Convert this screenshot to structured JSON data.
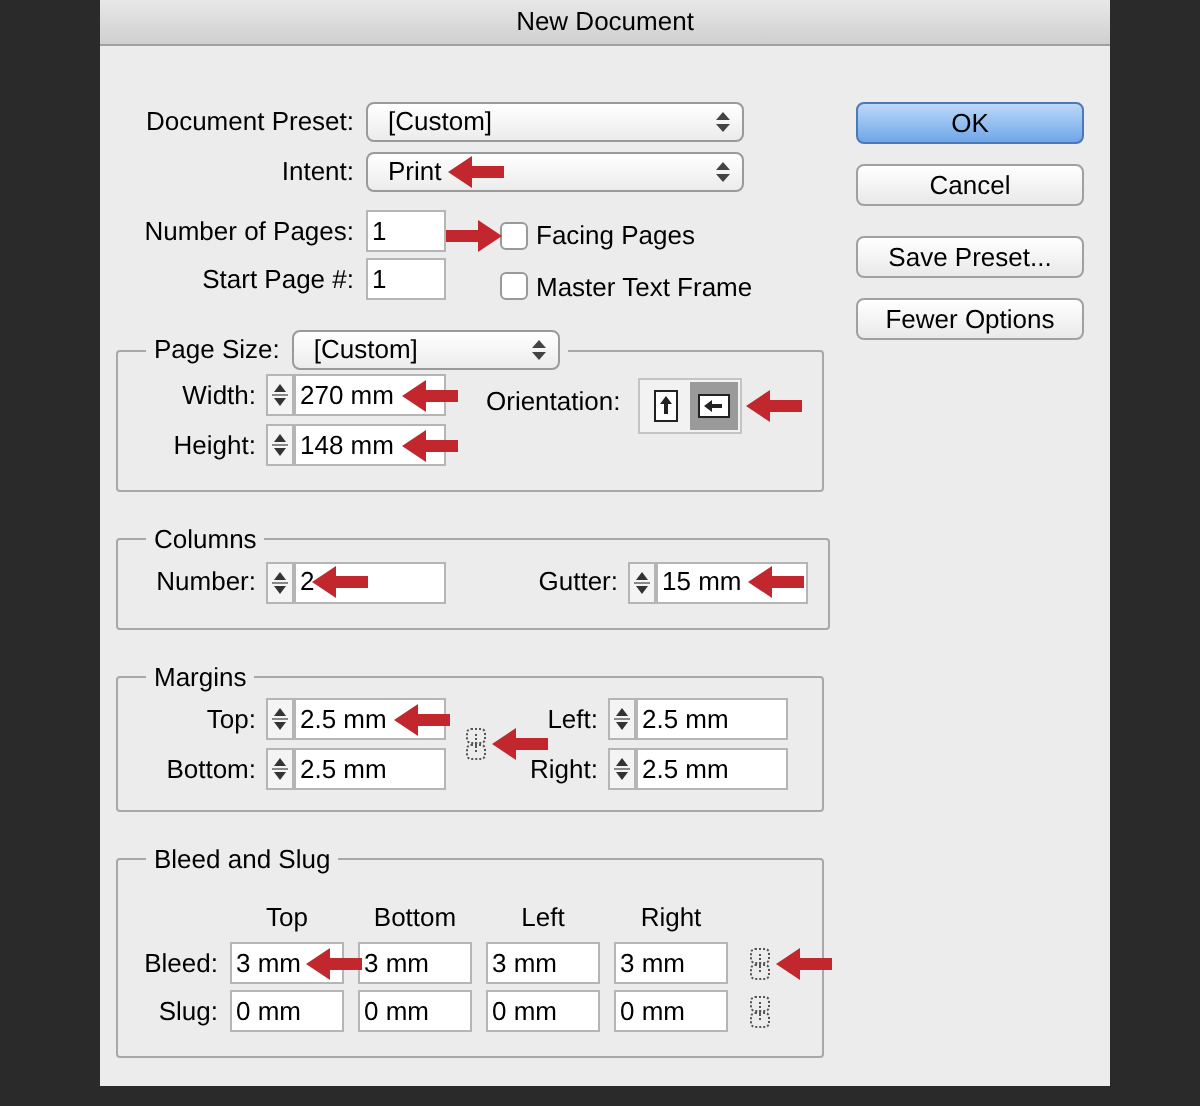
{
  "window": {
    "title": "New Document"
  },
  "document_preset": {
    "label": "Document Preset:",
    "value": "[Custom]"
  },
  "intent": {
    "label": "Intent:",
    "value": "Print",
    "arrow": true
  },
  "number_of_pages": {
    "label": "Number of Pages:",
    "value": "1"
  },
  "start_page": {
    "label": "Start Page #:",
    "value": "1"
  },
  "checkboxes": [
    {
      "label": "Facing Pages",
      "checked": false,
      "arrow": true
    },
    {
      "label": "Master Text Frame",
      "checked": false
    }
  ],
  "page_size": {
    "label": "Page Size:",
    "value": "[Custom]",
    "width": {
      "label": "Width:",
      "value": "270 mm",
      "arrow": true
    },
    "height": {
      "label": "Height:",
      "value": "148 mm",
      "arrow": true
    },
    "orientation": {
      "label": "Orientation:",
      "arrow": true,
      "options": [
        {
          "kind": "portrait",
          "selected": false
        },
        {
          "kind": "landscape",
          "selected": true
        }
      ]
    }
  },
  "columns": {
    "title": "Columns",
    "number": {
      "label": "Number:",
      "value": "2",
      "arrow": true
    },
    "gutter": {
      "label": "Gutter:",
      "value": "15 mm",
      "arrow": true
    }
  },
  "margins": {
    "title": "Margins",
    "top": {
      "label": "Top:",
      "value": "2.5 mm",
      "arrow": true
    },
    "bottom": {
      "label": "Bottom:",
      "value": "2.5 mm"
    },
    "left": {
      "label": "Left:",
      "value": "2.5 mm"
    },
    "right": {
      "label": "Right:",
      "value": "2.5 mm"
    },
    "link_arrow": true
  },
  "bleed_and_slug": {
    "title": "Bleed and Slug",
    "headers": [
      "Top",
      "Bottom",
      "Left",
      "Right"
    ],
    "rows": [
      {
        "label": "Bleed:",
        "link_arrow": true,
        "cells": [
          {
            "value": "3 mm",
            "arrow": true
          },
          {
            "value": "3 mm"
          },
          {
            "value": "3 mm"
          },
          {
            "value": "3 mm"
          }
        ]
      },
      {
        "label": "Slug:",
        "cells": [
          {
            "value": "0 mm"
          },
          {
            "value": "0 mm"
          },
          {
            "value": "0 mm"
          },
          {
            "value": "0 mm"
          }
        ]
      }
    ]
  },
  "buttons": [
    {
      "label": "OK",
      "default": true
    },
    {
      "label": "Cancel",
      "default": false
    },
    {
      "label": "Save Preset...",
      "default": false
    },
    {
      "label": "Fewer Options",
      "default": false
    }
  ]
}
